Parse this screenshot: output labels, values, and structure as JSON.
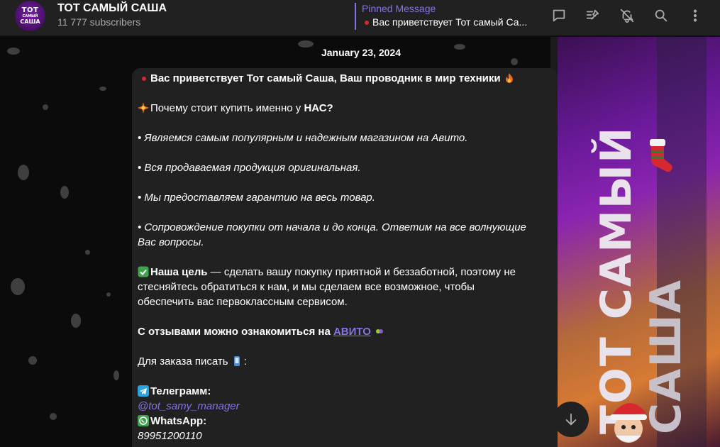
{
  "header": {
    "channel_title": "ТОТ САМЫЙ САША",
    "apple_glyph": "",
    "subscribers": "11 777 subscribers",
    "avatar_text": [
      "ТОТ",
      "САМЫЙ",
      "САША"
    ],
    "pinned_label": "Pinned Message",
    "pinned_text": "Вас приветствует Тот самый Са...",
    "icons": [
      "comments-icon",
      "pinned-list-icon",
      "mute-bell-icon",
      "search-icon",
      "more-vert-icon"
    ]
  },
  "chat": {
    "date": "January 23, 2024",
    "background_art_text": [
      "ТОТ САМЫЙ",
      "САША"
    ],
    "message": {
      "line1": "Вас приветствует Тот самый Саша, Ваш проводник в мир техники",
      "why_prefix": "Почему стоит купить именно у ",
      "why_bold": "НАС?",
      "bullet1": "• Являемся самым популярным и надежным магазином на Авито.",
      "bullet2": "• Вся продаваемая продукция оригинальная.",
      "bullet3": "• Мы предоставляем гарантию на весь товар.",
      "bullet4a": "• Сопровождение покупки от начала и до конца. Ответим на все волнующие",
      "bullet4b": "Вас вопросы.",
      "goal_bold": "Наша цель",
      "goal_rest1": " — сделать вашу покупку приятной и беззаботной, поэтому не",
      "goal_rest2": "стесняйтесь обратиться к нам, и мы сделаем все возможное, чтобы",
      "goal_rest3": "обеспечить вас первоклассным сервисом.",
      "reviews_prefix": "С отзывами можно ознакомиться на ",
      "reviews_link": "АВИТО",
      "order_text": "Для заказа писать",
      "order_colon": ":",
      "telegram_label": "Телеграмм:",
      "telegram_handle": "@tot_samy_manager",
      "whatsapp_label": "WhatsApp:",
      "whatsapp_number": "89951200110"
    }
  },
  "colors": {
    "accent": "#8774e1",
    "header_bg": "#212121",
    "bubble_bg": "#212121",
    "muted": "#aaaaaa"
  }
}
